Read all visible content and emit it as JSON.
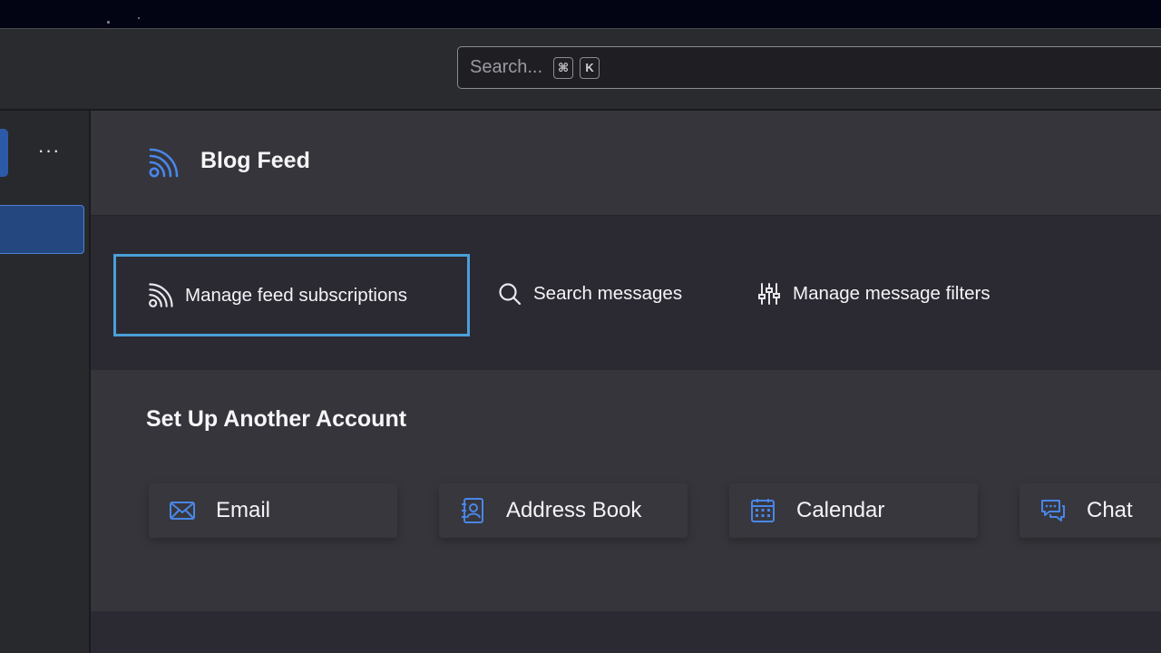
{
  "search": {
    "placeholder": "Search...",
    "shortcut_keys": [
      "⌘",
      "K"
    ]
  },
  "sidebar": {
    "more_label": "···"
  },
  "header": {
    "title": "Blog Feed",
    "icon": "rss-feed-icon"
  },
  "actions": [
    {
      "label": "Manage feed subscriptions",
      "icon": "rss-feed-icon"
    },
    {
      "label": "Search messages",
      "icon": "magnifier-icon"
    },
    {
      "label": "Manage message filters",
      "icon": "sliders-icon"
    }
  ],
  "setup": {
    "title": "Set Up Another Account",
    "cards": [
      {
        "label": "Email",
        "icon": "envelope-icon"
      },
      {
        "label": "Address Book",
        "icon": "address-book-icon"
      },
      {
        "label": "Calendar",
        "icon": "calendar-icon"
      },
      {
        "label": "Chat",
        "icon": "chat-bubbles-icon"
      }
    ]
  },
  "colors": {
    "accent_blue": "#4a86e8",
    "focus_ring": "#4a9fd8",
    "sidebar_selected": "#25477f"
  }
}
